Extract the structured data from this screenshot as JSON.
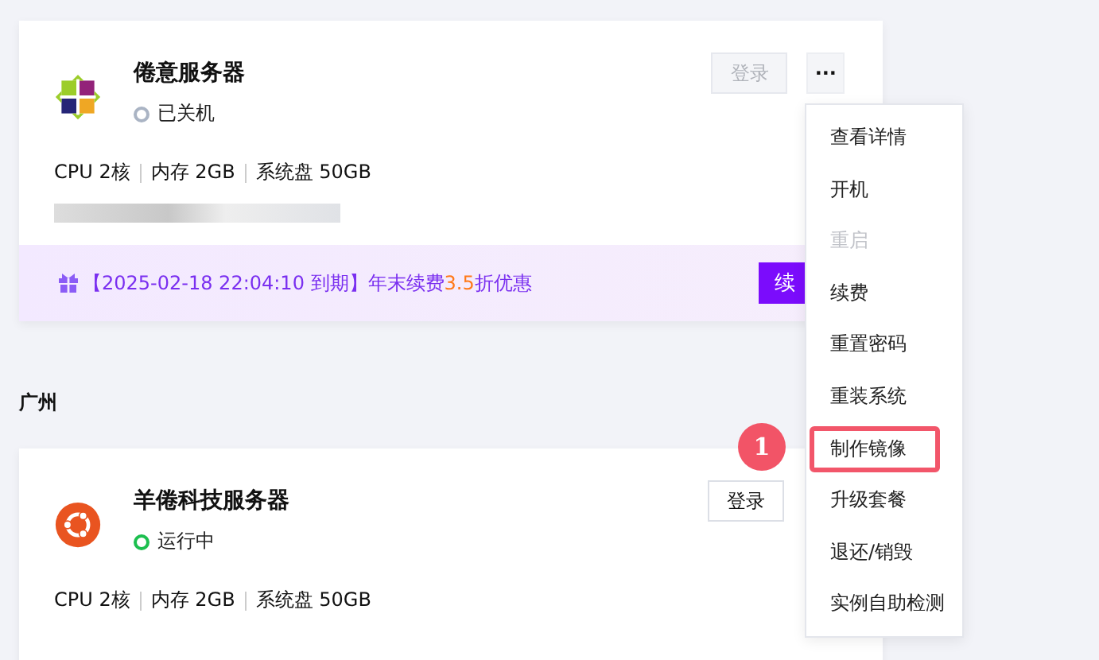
{
  "servers": [
    {
      "name": "倦意服务器",
      "kind": "centos",
      "status": "已关机",
      "running": false,
      "login": {
        "label": "登录",
        "disabled": true
      },
      "more": "···",
      "specs": [
        "CPU 2核",
        "内存 2GB",
        "系统盘 50GB"
      ],
      "promo": {
        "text": "【2025-02-18 22:04:10 到期】年末续费**3.5**折优惠",
        "button": "续"
      }
    },
    {
      "region": "广州",
      "name": "羊倦科技服务器",
      "kind": "ubuntu",
      "status": "运行中",
      "running": true,
      "login": {
        "label": "登录",
        "disabled": false
      },
      "specs": [
        "CPU 2核",
        "内存 2GB",
        "系统盘 50GB"
      ]
    }
  ],
  "menu": {
    "items": [
      {
        "label": "查看详情",
        "disabled": false,
        "highlighted": false
      },
      {
        "label": "开机",
        "disabled": false,
        "highlighted": false
      },
      {
        "label": "重启",
        "disabled": true,
        "highlighted": false
      },
      {
        "label": "续费",
        "disabled": false,
        "highlighted": false
      },
      {
        "label": "重置密码",
        "disabled": false,
        "highlighted": false
      },
      {
        "label": "重装系统",
        "disabled": false,
        "highlighted": false
      },
      {
        "label": "制作镜像",
        "disabled": false,
        "highlighted": true,
        "step": "1"
      },
      {
        "label": "升级套餐",
        "disabled": false,
        "highlighted": false
      },
      {
        "label": "退还/销毁",
        "disabled": false,
        "highlighted": false
      },
      {
        "label": "实例自助检测",
        "disabled": false,
        "highlighted": false
      }
    ]
  }
}
